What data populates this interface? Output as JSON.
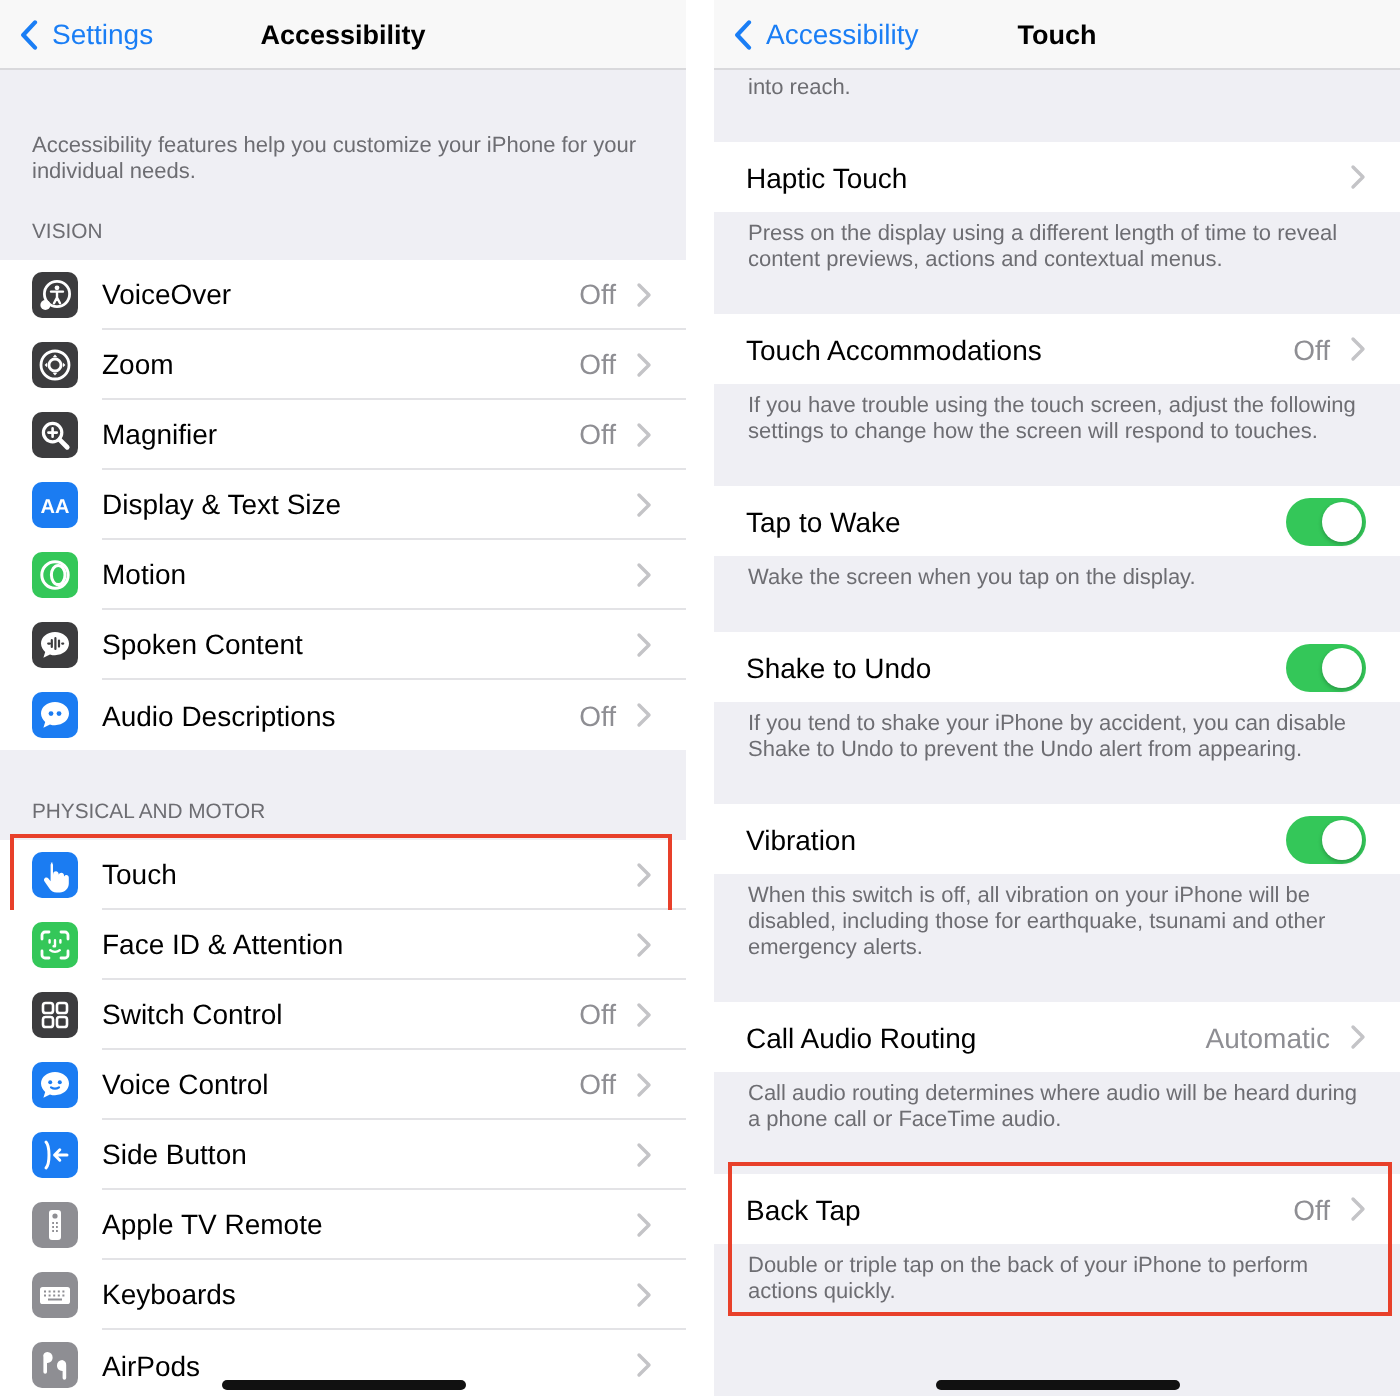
{
  "screens": [
    {
      "kind": "list",
      "nav": {
        "back": "Settings",
        "title": "Accessibility"
      },
      "intro": "Accessibility features help you customize your iPhone for your individual needs.",
      "sections": [
        {
          "header": "VISION",
          "rows": [
            {
              "label": "VoiceOver",
              "value": "Off",
              "color": "#3c3c3e",
              "highlighted": false
            },
            {
              "label": "Zoom",
              "value": "Off",
              "color": "#3c3c3e",
              "highlighted": false
            },
            {
              "label": "Magnifier",
              "value": "Off",
              "color": "#3c3c3e",
              "highlighted": false
            },
            {
              "label": "Display & Text Size",
              "icon_text": "AA",
              "color": "#1b7cf2",
              "highlighted": false
            },
            {
              "label": "Motion",
              "color": "#34c759",
              "highlighted": false
            },
            {
              "label": "Spoken Content",
              "color": "#3c3c3e",
              "highlighted": false
            },
            {
              "label": "Audio Descriptions",
              "value": "Off",
              "color": "#1b7cf2",
              "highlighted": false
            }
          ]
        },
        {
          "header": "PHYSICAL AND MOTOR",
          "rows": [
            {
              "label": "Touch",
              "color": "#1b7cf2",
              "highlighted": true
            },
            {
              "label": "Face ID & Attention",
              "color": "#34c759",
              "highlighted": false
            },
            {
              "label": "Switch Control",
              "value": "Off",
              "color": "#3c3c3e",
              "highlighted": false
            },
            {
              "label": "Voice Control",
              "value": "Off",
              "color": "#1b7cf2",
              "highlighted": false
            },
            {
              "label": "Side Button",
              "color": "#1b7cf2",
              "highlighted": false
            },
            {
              "label": "Apple TV Remote",
              "color": "#8e8e93",
              "highlighted": false
            },
            {
              "label": "Keyboards",
              "color": "#8e8e93",
              "highlighted": false
            },
            {
              "label": "AirPods",
              "color": "#8e8e93",
              "highlighted": false
            }
          ]
        }
      ]
    },
    {
      "kind": "detail",
      "nav": {
        "back": "Accessibility",
        "title": "Touch"
      },
      "top_footer": "into reach.",
      "groups": [
        {
          "kind": "link",
          "label": "Haptic Touch",
          "footer": "Press on the display using a different length of time to reveal content previews, actions and contextual menus.",
          "highlighted": false
        },
        {
          "kind": "link",
          "label": "Touch Accommodations",
          "value": "Off",
          "footer": "If you have trouble using the touch screen, adjust the following settings to change how the screen will respond to touches.",
          "highlighted": false
        },
        {
          "kind": "toggle",
          "label": "Tap to Wake",
          "on": true,
          "footer": "Wake the screen when you tap on the display.",
          "highlighted": false
        },
        {
          "kind": "toggle",
          "label": "Shake to Undo",
          "on": true,
          "footer": "If you tend to shake your iPhone by accident, you can disable Shake to Undo to prevent the Undo alert from appearing.",
          "highlighted": false
        },
        {
          "kind": "toggle",
          "label": "Vibration",
          "on": true,
          "footer": "When this switch is off, all vibration on your iPhone will be disabled, including those for earthquake, tsunami and other emergency alerts.",
          "highlighted": false
        },
        {
          "kind": "link",
          "label": "Call Audio Routing",
          "value": "Automatic",
          "footer": "Call audio routing determines where audio will be heard during a phone call or FaceTime audio.",
          "highlighted": false
        },
        {
          "kind": "link",
          "label": "Back Tap",
          "value": "Off",
          "footer": "Double or triple tap on the back of your iPhone to perform actions quickly.",
          "highlighted": true
        }
      ]
    }
  ]
}
